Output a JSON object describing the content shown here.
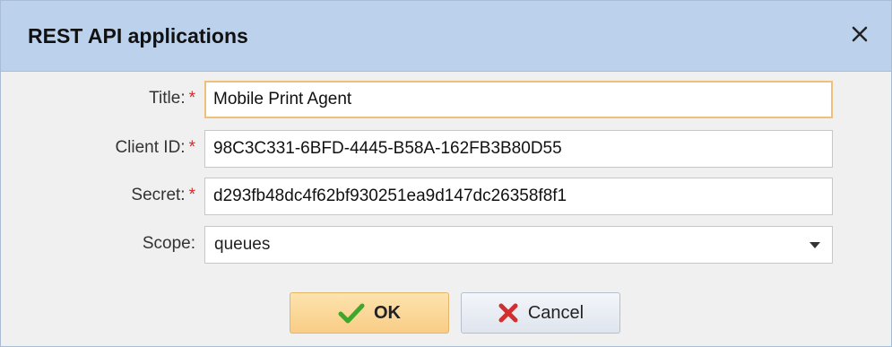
{
  "dialog": {
    "title": "REST API applications",
    "close_icon": "close-icon"
  },
  "form": {
    "required_marker": "*",
    "title": {
      "label": "Title:",
      "value": "Mobile Print Agent"
    },
    "client_id": {
      "label": "Client ID:",
      "value": "98C3C331-6BFD-4445-B58A-162FB3B80D55"
    },
    "secret": {
      "label": "Secret:",
      "value": "d293fb48dc4f62bf930251ea9d147dc26358f8f1"
    },
    "scope": {
      "label": "Scope:",
      "value": "queues"
    }
  },
  "buttons": {
    "ok_label": "OK",
    "ok_icon": "checkmark-icon",
    "cancel_label": "Cancel",
    "cancel_icon": "x-mark-icon"
  },
  "colors": {
    "titlebar": "#bcd1ec",
    "required": "#d42a2a",
    "focus_border": "#f0c07a",
    "ok_check": "#3ea82c",
    "cancel_x": "#d32f2f"
  }
}
